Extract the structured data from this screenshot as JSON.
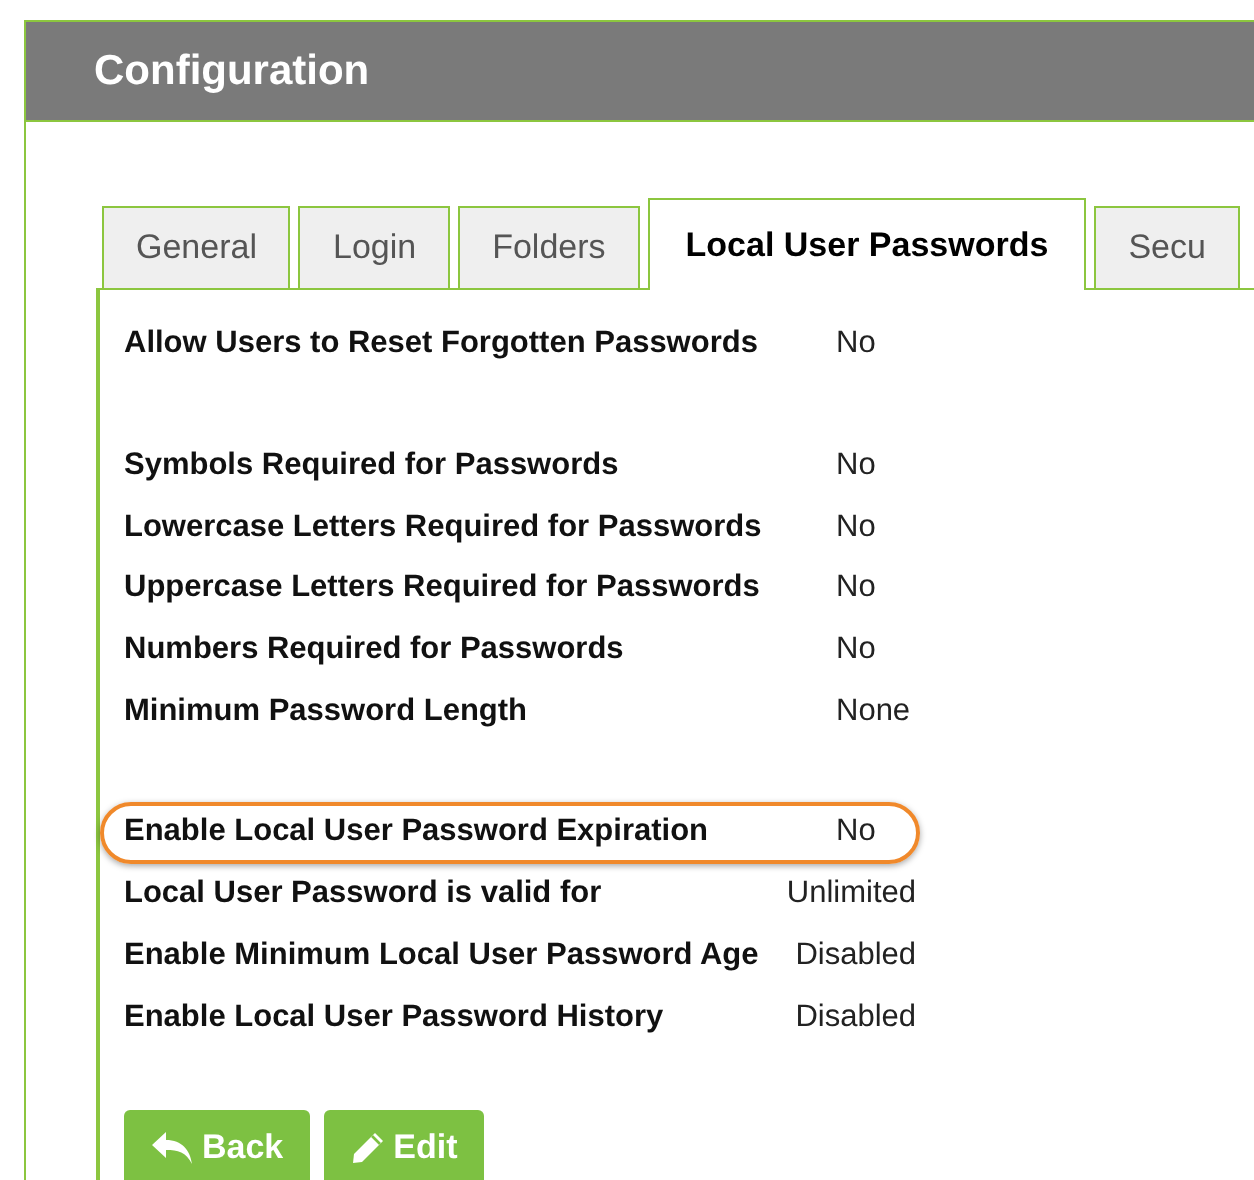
{
  "header": {
    "title": "Configuration"
  },
  "tabs": [
    {
      "label": "General",
      "selected": false
    },
    {
      "label": "Login",
      "selected": false
    },
    {
      "label": "Folders",
      "selected": false
    },
    {
      "label": "Local User Passwords",
      "selected": true
    },
    {
      "label": "Secu",
      "selected": false
    }
  ],
  "settings": [
    {
      "rows": [
        {
          "label": "Allow Users to Reset Forgotten Passwords",
          "value": "No",
          "highlighted": false
        }
      ]
    },
    {
      "rows": [
        {
          "label": "Symbols Required for Passwords",
          "value": "No",
          "highlighted": false
        },
        {
          "label": "Lowercase Letters Required for Passwords",
          "value": "No",
          "highlighted": false
        },
        {
          "label": "Uppercase Letters Required for Passwords",
          "value": "No",
          "highlighted": false
        },
        {
          "label": "Numbers Required for Passwords",
          "value": "No",
          "highlighted": false
        },
        {
          "label": "Minimum Password Length",
          "value": "None",
          "highlighted": false
        }
      ]
    },
    {
      "rows": [
        {
          "label": "Enable Local User Password Expiration",
          "value": "No",
          "highlighted": true
        },
        {
          "label": "Local User Password is valid for",
          "value": "Unlimited",
          "highlighted": false
        },
        {
          "label": "Enable Minimum Local User Password Age",
          "value": "Disabled",
          "highlighted": false
        },
        {
          "label": "Enable Local User Password History",
          "value": "Disabled",
          "highlighted": false
        }
      ]
    }
  ],
  "buttons": [
    {
      "kind": "back",
      "label": "Back"
    },
    {
      "kind": "edit",
      "label": "Edit"
    }
  ]
}
